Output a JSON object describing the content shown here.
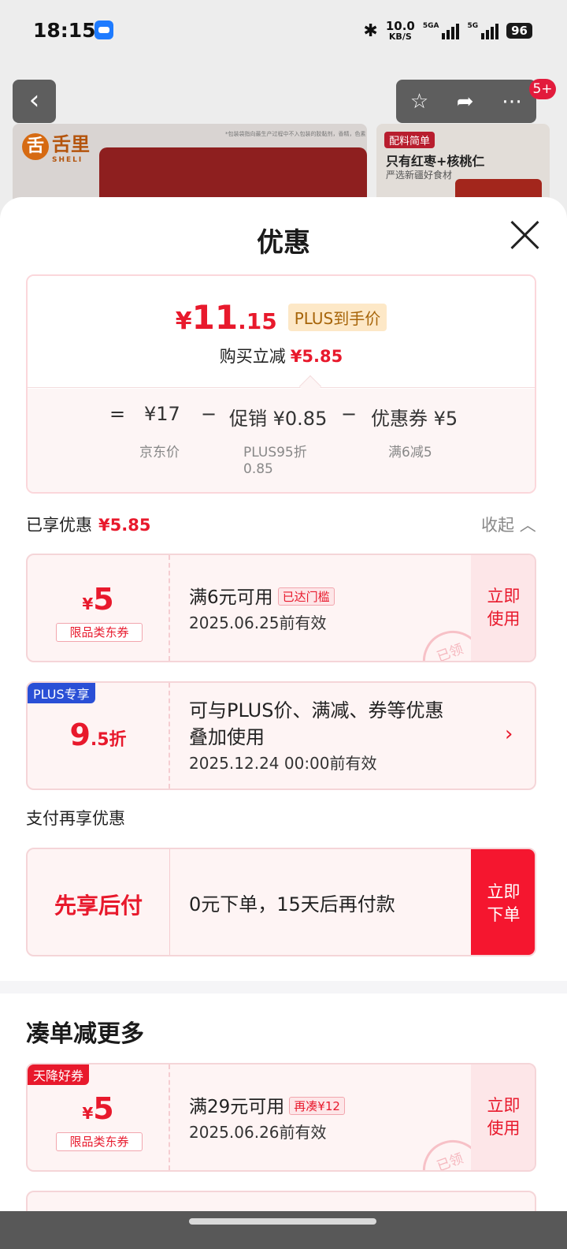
{
  "status_bar": {
    "time": "18:15",
    "bluetooth_icon": "bluetooth-icon",
    "net_speed_value": "10.0",
    "net_speed_unit": "KB/S",
    "sim1_label": "5GA",
    "sim2_label": "5G",
    "battery": "96"
  },
  "product_nav": {
    "back_icon": "chevron-left-icon",
    "actions": [
      "star-icon",
      "share-icon",
      "more-icon"
    ],
    "badge": "5+"
  },
  "product_preview": {
    "brand_glyph": "舌",
    "brand_name": "舌里",
    "brand_sub": "SHELI",
    "note": "*包装袋指向最生产过程中不入包装的胶黏剂，香精，色素",
    "right_tag": "配料简单",
    "right_title": "只有红枣+核桃仁",
    "right_sub": "严选新疆好食材"
  },
  "sheet": {
    "title": "优惠",
    "close_icon": "close-icon"
  },
  "summary": {
    "price_symbol": "¥",
    "price_int": "11",
    "price_dec": ".15",
    "plus_tag": "PLUS到手价",
    "reduce_label": "购买立减",
    "reduce_value": "¥5.85",
    "formula": {
      "equals": "=",
      "base_price": "¥17",
      "base_label": "京东价",
      "minus1": "−",
      "promo": "促销 ¥0.85",
      "promo_label_1": "PLUS95折",
      "promo_label_2": "0.85",
      "minus2": "−",
      "coupon": "优惠券 ¥5",
      "coupon_label": "满6减5"
    }
  },
  "enjoyed": {
    "label": "已享优惠",
    "value": "¥5.85",
    "collapse": "收起"
  },
  "coupons_enjoyed": [
    {
      "symbol": "¥",
      "amount": "5",
      "kind": "限品类东券",
      "condition": "满6元可用",
      "chip": "已达门槛",
      "expiry": "2025.06.25前有效",
      "action_1": "立即",
      "action_2": "使用",
      "stamp": "已领"
    }
  ],
  "plus_offer": {
    "ribbon": "PLUS专享",
    "amount": "9",
    "amount_dec": ".5折",
    "line1": "可与PLUS价、满减、券等优惠",
    "line2": "叠加使用",
    "expiry": "2025.12.24 00:00前有效"
  },
  "payment": {
    "section_title": "支付再享优惠",
    "name": "先享后付",
    "desc": "0元下单，15天后再付款",
    "action_1": "立即",
    "action_2": "下单"
  },
  "more": {
    "section_title": "凑单减更多",
    "coupons": [
      {
        "ribbon": "天降好券",
        "symbol": "¥",
        "amount": "5",
        "kind": "限品类东券",
        "condition": "满29元可用",
        "chip": "再凑¥12",
        "expiry": "2025.06.26前有效",
        "action_1": "立即",
        "action_2": "使用",
        "stamp": "已领"
      }
    ]
  },
  "colors": {
    "accent_red": "#e8192c",
    "plus_blue": "#2a4fd6",
    "plus_gold_bg": "#fde8c7"
  }
}
